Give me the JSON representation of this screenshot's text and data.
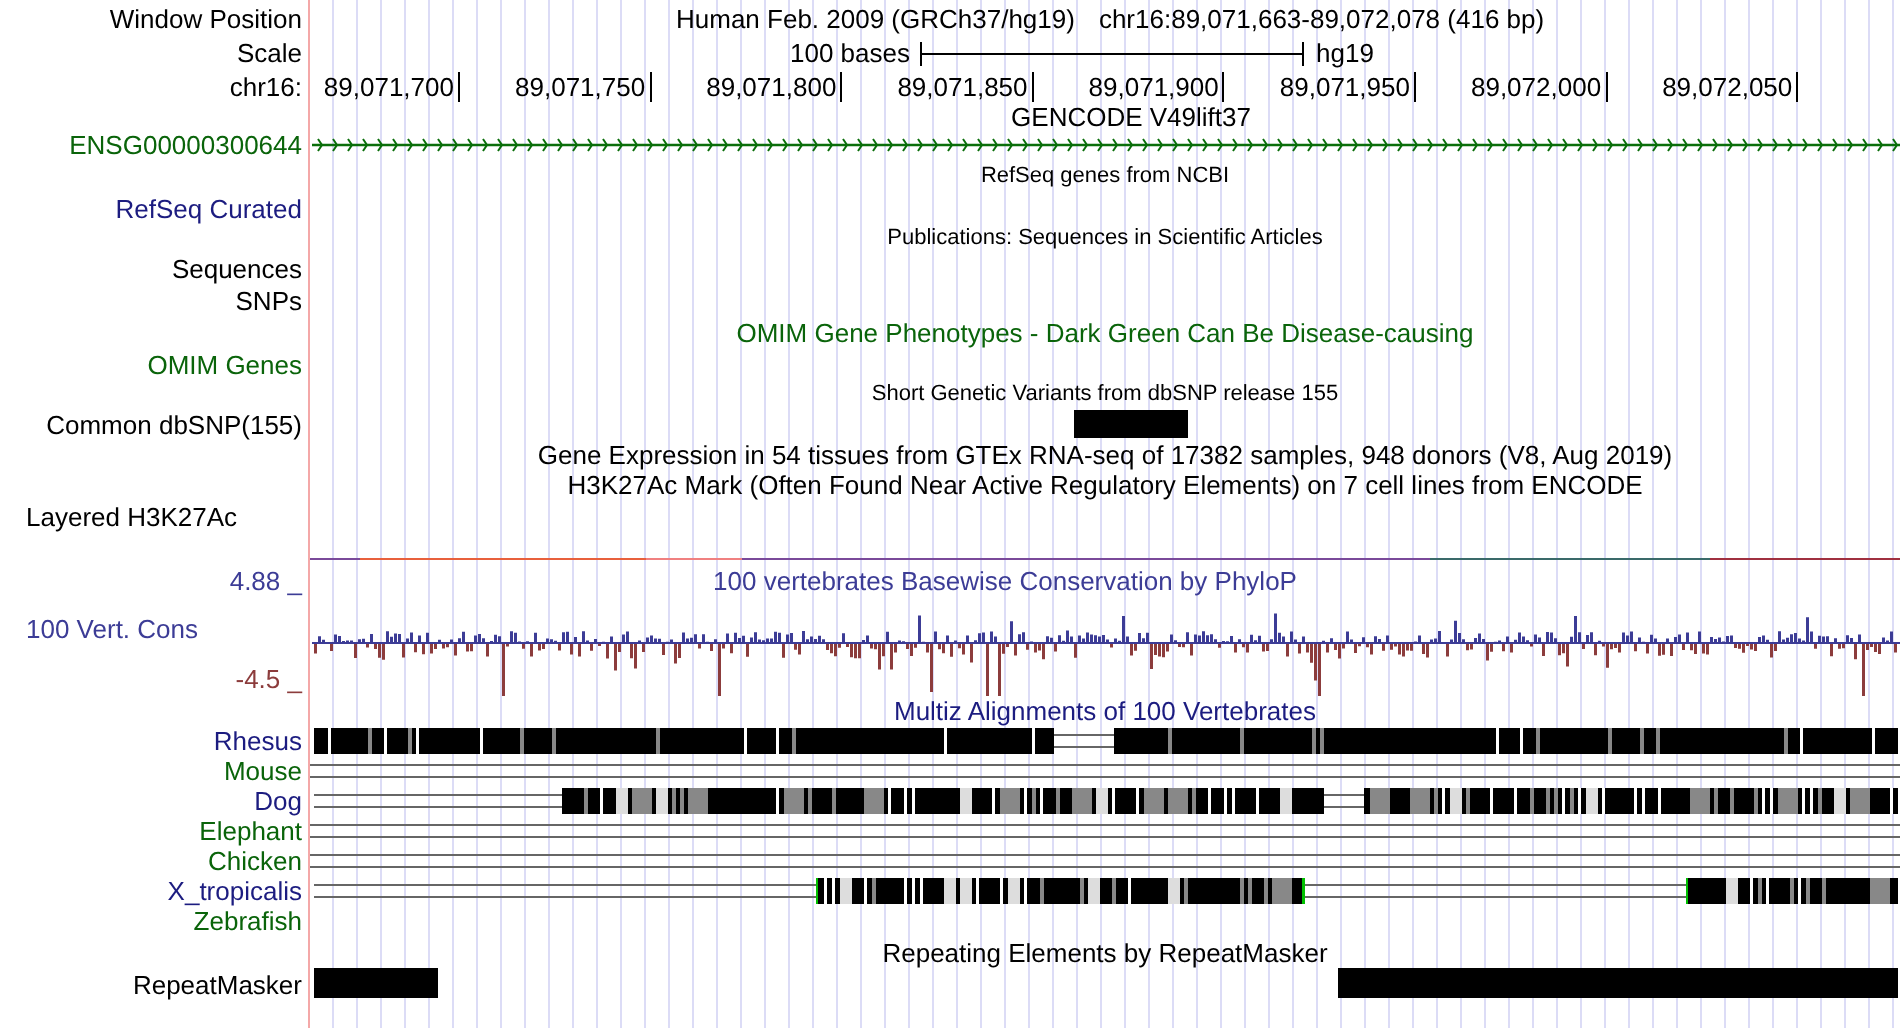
{
  "header": {
    "label": "Window Position",
    "assembly": "Human Feb. 2009 (GRCh37/hg19)",
    "position": "chr16:89,071,663-89,072,078 (416 bp)"
  },
  "scale": {
    "label": "Scale",
    "bar_label": "100 bases",
    "assembly": "hg19"
  },
  "ruler": {
    "label": "chr16:",
    "ticks": [
      "89,071,700",
      "89,071,750",
      "89,071,800",
      "89,071,850",
      "89,071,900",
      "89,071,950",
      "89,072,000",
      "89,072,050"
    ]
  },
  "gencode": {
    "title": "GENCODE V49lift37",
    "gene": "ENSG00000300644"
  },
  "refseq": {
    "title": "RefSeq genes from NCBI",
    "label": "RefSeq Curated"
  },
  "publications": {
    "title": "Publications: Sequences in Scientific Articles"
  },
  "sequences_label": "Sequences",
  "snps_label": "SNPs",
  "omim": {
    "title": "OMIM Gene Phenotypes - Dark Green Can Be Disease-causing",
    "label": "OMIM Genes"
  },
  "dbsnp": {
    "title": "Short Genetic Variants from dbSNP release 155",
    "label": "Common dbSNP(155)"
  },
  "gtex": {
    "title": "Gene Expression in 54 tissues from GTEx RNA-seq of 17382 samples, 948 donors (V8, Aug 2019)"
  },
  "h3k27ac": {
    "title": "H3K27Ac Mark (Often Found Near Active Regulatory Elements) on 7 cell lines from ENCODE",
    "label": "Layered H3K27Ac"
  },
  "conservation": {
    "title": "100 vertebrates Basewise Conservation by PhyloP",
    "label": "100 Vert. Cons",
    "max": "4.88 _",
    "min": "-4.5 _"
  },
  "multiz": {
    "title": "Multiz Alignments of 100 Vertebrates",
    "species": [
      {
        "name": "Rhesus",
        "color": "#1c1c80"
      },
      {
        "name": "Mouse",
        "color": "#0a640a"
      },
      {
        "name": "Dog",
        "color": "#1c1c80"
      },
      {
        "name": "Elephant",
        "color": "#0a640a"
      },
      {
        "name": "Chicken",
        "color": "#0a640a"
      },
      {
        "name": "X_tropicalis",
        "color": "#1c1c80"
      },
      {
        "name": "Zebrafish",
        "color": "#0a640a"
      }
    ]
  },
  "repeatmasker": {
    "title": "Repeating Elements by RepeatMasker",
    "label": "RepeatMasker"
  }
}
